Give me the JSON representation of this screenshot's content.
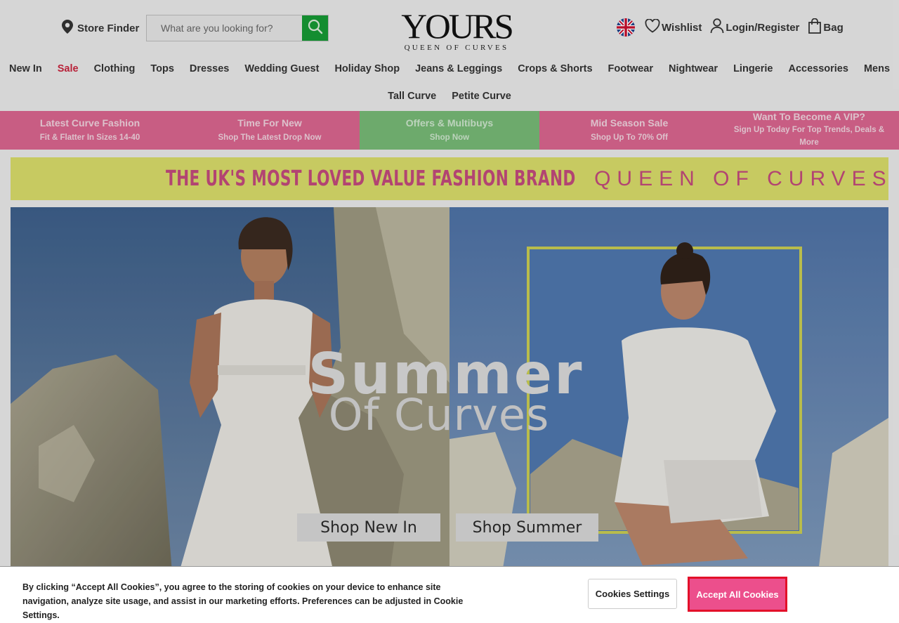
{
  "header": {
    "store_finder": "Store Finder",
    "search_placeholder": "What are you looking for?",
    "logo_main": "YOURS",
    "logo_sub": "QUEEN OF CURVES",
    "wishlist": "Wishlist",
    "login": "Login/Register",
    "bag": "Bag"
  },
  "nav": {
    "row1": [
      "New In",
      "Sale",
      "Clothing",
      "Tops",
      "Dresses",
      "Wedding Guest",
      "Holiday Shop",
      "Jeans & Leggings",
      "Crops & Shorts",
      "Footwear",
      "Nightwear",
      "Lingerie",
      "Accessories",
      "Mens"
    ],
    "row2": [
      "Tall Curve",
      "Petite Curve"
    ]
  },
  "promos": [
    {
      "title": "Latest Curve Fashion",
      "sub": "Fit & Flatter In Sizes 14-40"
    },
    {
      "title": "Time For New",
      "sub": "Shop The Latest Drop Now"
    },
    {
      "title": "Offers & Multibuys",
      "sub": "Shop Now"
    },
    {
      "title": "Mid Season Sale",
      "sub": "Shop Up To 70% Off"
    },
    {
      "title": "Want To Become A VIP?",
      "sub": "Sign Up Today For Top Trends, Deals & More"
    }
  ],
  "brand_banner": {
    "left": "THE UK'S MOST LOVED VALUE FASHION BRAND",
    "right": "QUEEN OF CURVES"
  },
  "hero": {
    "title_line1": "Summer",
    "title_line2": "Of Curves",
    "btn_new_in": "Shop New In",
    "btn_summer": "Shop Summer"
  },
  "cookie": {
    "text": "By clicking “Accept All Cookies”, you agree to the storing of cookies on your device to enhance site navigation, analyze site usage, and assist in our marketing efforts. Preferences can be adjusted in Cookie Settings.",
    "settings_label": "Cookies Settings",
    "accept_label": "Accept All Cookies"
  },
  "colors": {
    "search_button": "#169a35",
    "sale_text": "#c8253e",
    "promo_pink": "#d9658f",
    "promo_green": "#77b976",
    "banner_yellow": "#d8dc6a",
    "accept_button": "#ec4f8c",
    "accept_border": "#e3102a"
  }
}
